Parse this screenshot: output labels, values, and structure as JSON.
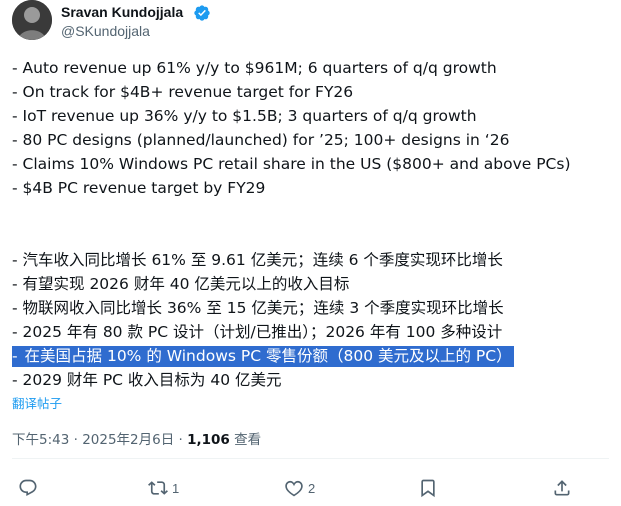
{
  "author": {
    "name": "Sravan Kundojjala",
    "handle": "@SKundojjala"
  },
  "tweet": {
    "lines": [
      "- Auto revenue up 61% y/y to $961M; 6 quarters of q/q growth",
      "- On track for $4B+ revenue target for FY26",
      "- IoT revenue up 36% y/y to $1.5B; 3 quarters of q/q growth",
      "- 80 PC designs (planned/launched) for ’25; 100+ designs in ‘26",
      "- Claims 10% Windows PC retail share in the US ($800+ and above PCs)",
      "- $4B PC revenue target by FY29",
      "- 汽车收入同比增长 61% 至 9.61 亿美元；连续 6 个季度实现环比增长",
      "- 有望实现 2026 财年 40 亿美元以上的收入目标",
      "- 物联网收入同比增长 36% 至 15 亿美元；连续 3 个季度实现环比增长",
      "- 2025 年有 80 款 PC 设计（计划/已推出）；2026 年有 100 多种设计",
      "在美国占据 10% 的 Windows PC 零售份额（800 美元及以上的 PC）",
      "- 2029 财年 PC 收入目标为 40 亿美元"
    ],
    "highlight_prefix": "- ",
    "translate_label": "翻译帖子"
  },
  "meta": {
    "timestamp": "下午5:43 · 2025年2月6日 · ",
    "views_count": "1,106",
    "views_label": " 查看"
  },
  "actions": {
    "retweet_count": "1",
    "like_count": "2"
  },
  "colors": {
    "highlight_bg": "#2f6ccf",
    "link": "#1d9bf0",
    "verified": "#1d9bf0",
    "muted": "#536471"
  }
}
